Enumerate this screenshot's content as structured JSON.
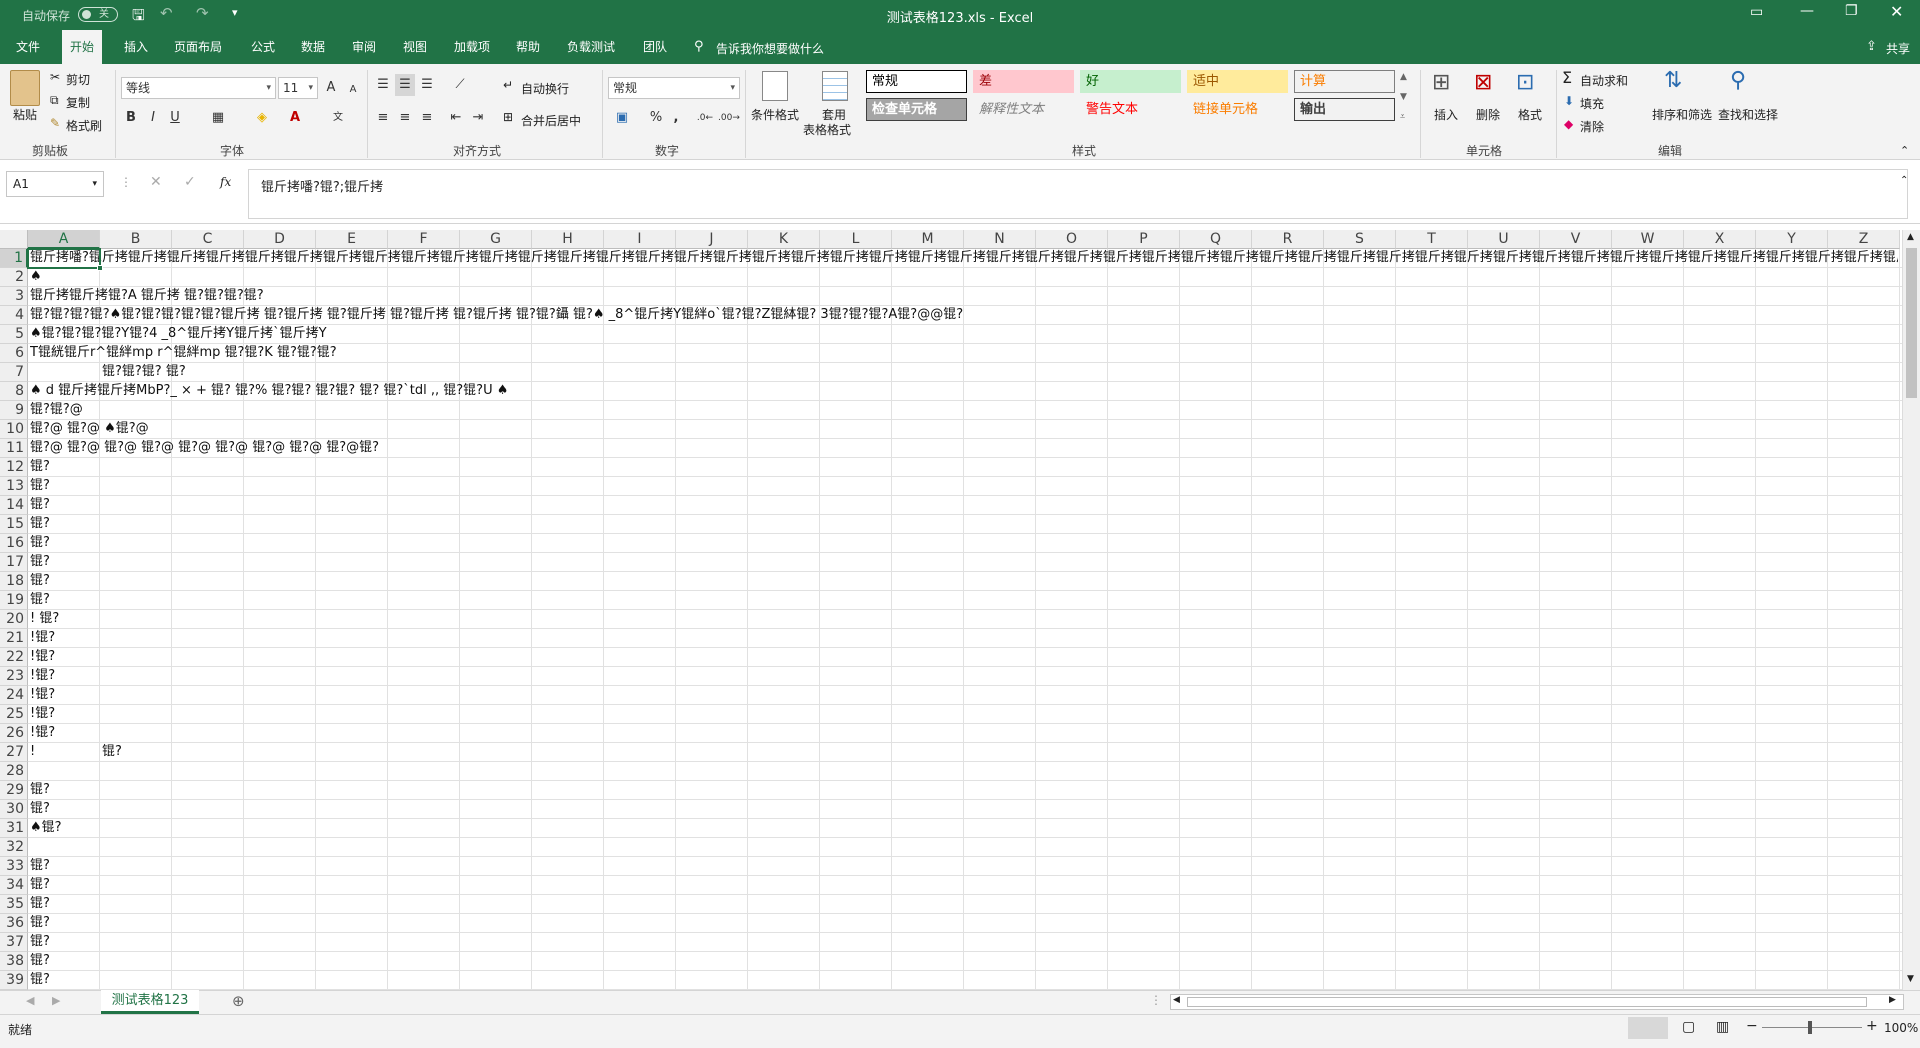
{
  "titlebar": {
    "autosave_label": "自动保存",
    "autosave_state": "关",
    "window_title": "测试表格123.xls  -  Excel"
  },
  "tabs": [
    "文件",
    "开始",
    "插入",
    "页面布局",
    "公式",
    "数据",
    "审阅",
    "视图",
    "加载项",
    "帮助",
    "负载测试",
    "团队"
  ],
  "active_tab": "开始",
  "tell_me": "告诉我你想要做什么",
  "share": "共享",
  "ribbon": {
    "clipboard": {
      "paste": "粘贴",
      "cut": "剪切",
      "copy": "复制",
      "format_painter": "格式刷",
      "group": "剪贴板"
    },
    "font": {
      "name": "等线",
      "size": "11",
      "bold": "B",
      "italic": "I",
      "underline": "U",
      "grow": "A",
      "shrink": "A",
      "group": "字体"
    },
    "alignment": {
      "wrap": "自动换行",
      "merge": "合并后居中",
      "group": "对齐方式"
    },
    "number": {
      "format": "常规",
      "percent": "%",
      "comma": ",",
      "group": "数字"
    },
    "styles": {
      "cond_format": "条件格式",
      "table_format_1": "套用",
      "table_format_2": "表格格式",
      "group": "样式",
      "cells": [
        {
          "label": "常规",
          "bg": "#ffffff",
          "fg": "#000000",
          "border": "#000000"
        },
        {
          "label": "差",
          "bg": "#ffc7ce",
          "fg": "#9c0006",
          "border": "#ffc7ce"
        },
        {
          "label": "好",
          "bg": "#c6efce",
          "fg": "#006100",
          "border": "#c6efce"
        },
        {
          "label": "适中",
          "bg": "#ffeb9c",
          "fg": "#9c5700",
          "border": "#ffeb9c"
        },
        {
          "label": "计算",
          "bg": "#f2f2f2",
          "fg": "#fa7d00",
          "border": "#7f7f7f"
        },
        {
          "label": "检查单元格",
          "bg": "#a5a5a5",
          "fg": "#ffffff",
          "border": "#3f3f3f"
        },
        {
          "label": "解释性文本",
          "bg": "#f3f3f3",
          "fg": "#7f7f7f",
          "border": "#f3f3f3"
        },
        {
          "label": "警告文本",
          "bg": "#f3f3f3",
          "fg": "#ff0000",
          "border": "#f3f3f3"
        },
        {
          "label": "链接单元格",
          "bg": "#f3f3f3",
          "fg": "#fa7d00",
          "border": "#f3f3f3"
        },
        {
          "label": "输出",
          "bg": "#f2f2f2",
          "fg": "#3f3f3f",
          "border": "#3f3f3f"
        }
      ]
    },
    "cells": {
      "insert": "插入",
      "delete": "删除",
      "format": "格式",
      "group": "单元格"
    },
    "editing": {
      "autosum": "自动求和",
      "fill": "填充",
      "clear": "清除",
      "sort": "排序和筛选",
      "find": "查找和选择",
      "group": "编辑"
    }
  },
  "formula_bar": {
    "name_box": "A1",
    "fx": "fx",
    "value": "锟斤拷噃?锟?;锟斤拷"
  },
  "columns": [
    "A",
    "B",
    "C",
    "D",
    "E",
    "F",
    "G",
    "H",
    "I",
    "J",
    "K",
    "L",
    "M",
    "N",
    "O",
    "P",
    "Q",
    "R",
    "S",
    "T",
    "U",
    "V",
    "W",
    "X",
    "Y",
    "Z"
  ],
  "rows": [
    "1",
    "2",
    "3",
    "4",
    "5",
    "6",
    "7",
    "8",
    "9",
    "10",
    "11",
    "12",
    "13",
    "14",
    "15",
    "16",
    "17",
    "18",
    "19",
    "20",
    "21",
    "22",
    "23",
    "24",
    "25",
    "26",
    "27",
    "28",
    "29",
    "30",
    "31",
    "32",
    "33",
    "34",
    "35",
    "36",
    "37",
    "38",
    "39"
  ],
  "cells": [
    {
      "row": 1,
      "col": 0,
      "text": "锟斤拷噃?锟斤拷锟斤拷锟斤拷锟斤拷锟斤拷锟斤拷锟斤拷锟斤拷锟斤拷锟斤拷锟斤拷锟斤拷锟斤拷锟斤拷锟斤拷锟斤拷锟斤拷锟斤拷锟斤拷锟斤拷锟斤拷锟斤拷锟斤拷锟斤拷锟斤拷锟斤拷锟斤拷锟斤拷锟斤拷锟斤拷锟斤拷锟斤拷锟斤拷锟斤拷锟斤拷锟斤拷锟斤拷锟斤拷锟斤拷锟斤拷锟斤拷锟斤拷锟斤拷锟斤拷锟斤拷锟斤拷锟斤拷锟斤拷"
    },
    {
      "row": 2,
      "col": 0,
      "text": "♠"
    },
    {
      "row": 3,
      "col": 0,
      "text": "锟斤拷锟斤拷锟?A 锟斤拷 锟?锟?锟?锟?"
    },
    {
      "row": 4,
      "col": 0,
      "text": "锟?锟?锟?锟?♠锟?锟?锟?锟?锟?锟斤拷 锟?锟斤拷 锟?锟斤拷 锟?锟斤拷 锟?锟斤拷 锟?锟?鑷 锟?♠ _8^锟斤拷Y锟絆o`锟?锟?Z锟絊锟? 3锟?锟?锟?A锟?@@锟?"
    },
    {
      "row": 5,
      "col": 0,
      "text": "♠锟?锟?锟?锟?Y锟?4 _8^锟斤拷Y锟斤拷`锟斤拷Y"
    },
    {
      "row": 6,
      "col": 0,
      "text": "T锟絖锟斤r^锟絆mp r^锟絆mp 锟?锟?K 锟?锟?锟?"
    },
    {
      "row": 7,
      "col": 1,
      "text": "锟?锟?锟? 锟?"
    },
    {
      "row": 8,
      "col": 0,
      "text": "♠ d 锟斤拷锟斤拷MbP?_ × + 锟? 锟?% 锟?锟? 锟?锟? 锟? 锟?`tdl ,, 锟?锟?U ♠"
    },
    {
      "row": 9,
      "col": 0,
      "text": "  锟?锟?@"
    },
    {
      "row": 10,
      "col": 0,
      "text": "锟?@ 锟?@ ♠锟?@"
    },
    {
      "row": 11,
      "col": 0,
      "text": "锟?@ 锟?@ 锟?@ 锟?@ 锟?@ 锟?@ 锟?@ 锟?@ 锟?@锟?"
    },
    {
      "row": 12,
      "col": 0,
      "text": "锟?"
    },
    {
      "row": 13,
      "col": 0,
      "text": "锟?"
    },
    {
      "row": 14,
      "col": 0,
      "text": " 锟?"
    },
    {
      "row": 15,
      "col": 0,
      "text": "锟?"
    },
    {
      "row": 16,
      "col": 0,
      "text": "锟?"
    },
    {
      "row": 17,
      "col": 0,
      "text": "锟?"
    },
    {
      "row": 18,
      "col": 0,
      "text": "锟?"
    },
    {
      "row": 19,
      "col": 0,
      "text": "锟?"
    },
    {
      "row": 20,
      "col": 0,
      "text": "! 锟?"
    },
    {
      "row": 21,
      "col": 0,
      "text": "!锟?"
    },
    {
      "row": 22,
      "col": 0,
      "text": " !锟?"
    },
    {
      "row": 23,
      "col": 0,
      "text": "!锟?"
    },
    {
      "row": 24,
      "col": 0,
      "text": "!锟?"
    },
    {
      "row": 25,
      "col": 0,
      "text": "!锟?"
    },
    {
      "row": 26,
      "col": 0,
      "text": "!锟?"
    },
    {
      "row": 27,
      "col": 0,
      "text": "!"
    },
    {
      "row": 27,
      "col": 1,
      "text": "锟?"
    },
    {
      "row": 29,
      "col": 0,
      "text": "锟?"
    },
    {
      "row": 30,
      "col": 0,
      "text": " 锟?"
    },
    {
      "row": 31,
      "col": 0,
      "text": " ♠锟?"
    },
    {
      "row": 33,
      "col": 0,
      "text": "锟?"
    },
    {
      "row": 34,
      "col": 0,
      "text": " 锟?"
    },
    {
      "row": 35,
      "col": 0,
      "text": " 锟?"
    },
    {
      "row": 36,
      "col": 0,
      "text": " 锟?"
    },
    {
      "row": 37,
      "col": 0,
      "text": " 锟?"
    },
    {
      "row": 38,
      "col": 0,
      "text": "锟?"
    },
    {
      "row": 39,
      "col": 0,
      "text": "锟?"
    }
  ],
  "sheet_tab": "测试表格123",
  "status": {
    "ready": "就绪",
    "zoom": "100%"
  },
  "colors": {
    "excel_green": "#217346",
    "ribbon_bg": "#f3f3f3"
  }
}
